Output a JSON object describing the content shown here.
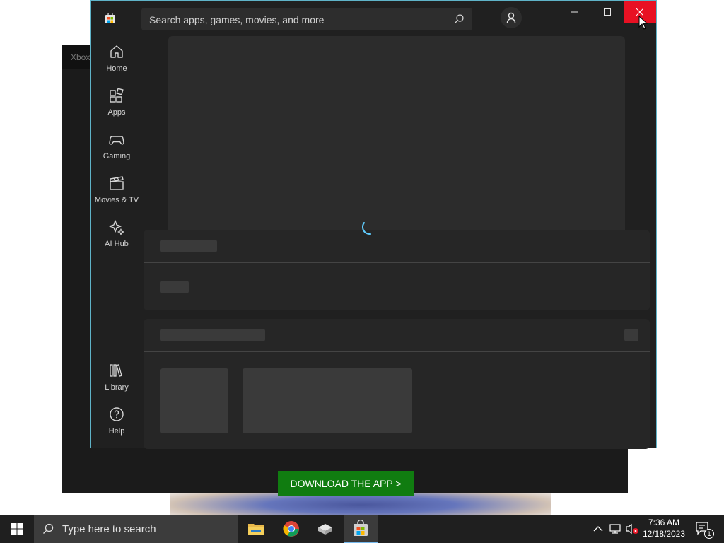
{
  "xbox_window": {
    "title": "Xbox",
    "download_button": "DOWNLOAD THE APP >"
  },
  "store": {
    "search_placeholder": "Search apps, games, movies, and more",
    "nav": [
      {
        "label": "Home",
        "icon": "home-icon"
      },
      {
        "label": "Apps",
        "icon": "apps-icon"
      },
      {
        "label": "Gaming",
        "icon": "gamepad-icon"
      },
      {
        "label": "Movies & TV",
        "icon": "clapperboard-icon"
      },
      {
        "label": "AI Hub",
        "icon": "sparkle-icon"
      },
      {
        "label": "Library",
        "icon": "library-icon"
      },
      {
        "label": "Help",
        "icon": "help-icon"
      }
    ],
    "colors": {
      "accent": "#5fb3c8",
      "close_hover": "#e81123"
    }
  },
  "taskbar": {
    "search_placeholder": "Type here to search",
    "time": "7:36 AM",
    "date": "12/18/2023",
    "notification_count": "1",
    "apps": [
      "file-explorer-icon",
      "chrome-icon",
      "app-icon",
      "microsoft-store-icon"
    ]
  }
}
